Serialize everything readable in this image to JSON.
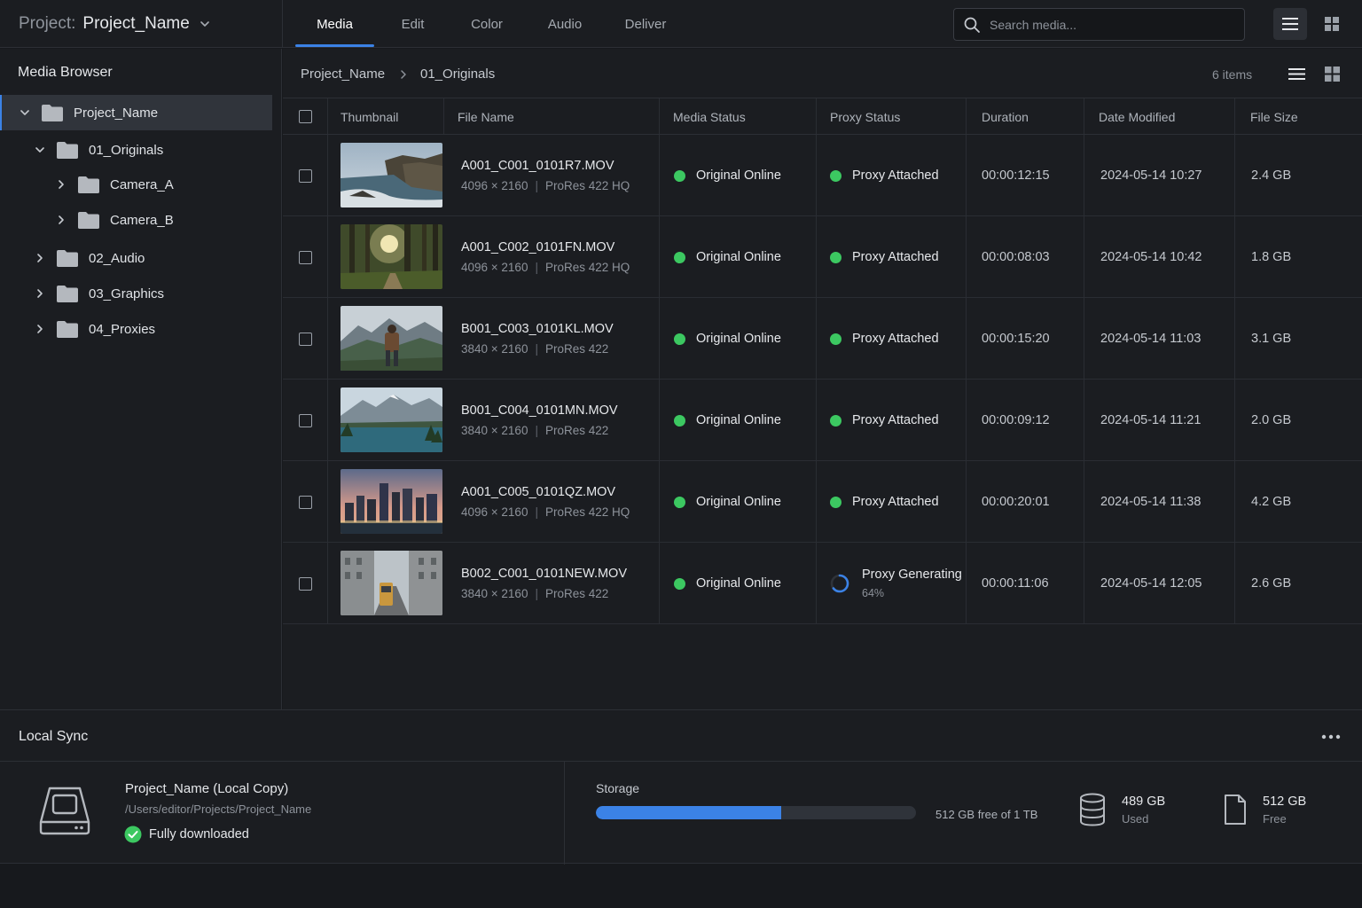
{
  "header": {
    "project_label": "Project:",
    "project_name": "Project_Name",
    "tabs": [
      {
        "label": "Media",
        "active": true
      },
      {
        "label": "Edit"
      },
      {
        "label": "Color"
      },
      {
        "label": "Audio"
      },
      {
        "label": "Deliver"
      }
    ],
    "search_placeholder": "Search media..."
  },
  "sidebar": {
    "title": "Media Browser",
    "tree": [
      {
        "label": "Project_Name",
        "expanded": true,
        "selected": true
      },
      {
        "label": "01_Originals",
        "expanded": true
      },
      {
        "label": "Camera_A"
      },
      {
        "label": "Camera_B"
      },
      {
        "label": "02_Audio"
      },
      {
        "label": "03_Graphics"
      },
      {
        "label": "04_Proxies"
      }
    ]
  },
  "main": {
    "breadcrumb": [
      "Project_Name",
      "01_Originals"
    ],
    "item_count": "6 items",
    "columns": [
      "Thumbnail",
      "File Name",
      "Media Status",
      "Proxy Status",
      "Duration",
      "Date Modified",
      "File Size"
    ],
    "rows": [
      {
        "file": "A001_C001_0101R7.MOV",
        "resolution": "4096 × 2160",
        "codec": "ProRes 422 HQ",
        "media_status": "Original Online",
        "proxy_status": "Proxy Attached",
        "duration": "00:00:12:15",
        "date": "2024-05-14 10:27",
        "size": "2.4 GB",
        "thumb": "coast"
      },
      {
        "file": "A001_C002_0101FN.MOV",
        "resolution": "4096 × 2160",
        "codec": "ProRes 422 HQ",
        "media_status": "Original Online",
        "proxy_status": "Proxy Attached",
        "duration": "00:00:08:03",
        "date": "2024-05-14 10:42",
        "size": "1.8 GB",
        "thumb": "forest"
      },
      {
        "file": "B001_C003_0101KL.MOV",
        "resolution": "3840 × 2160",
        "codec": "ProRes 422",
        "media_status": "Original Online",
        "proxy_status": "Proxy Attached",
        "duration": "00:00:15:20",
        "date": "2024-05-14 11:03",
        "size": "3.1 GB",
        "thumb": "hiker"
      },
      {
        "file": "B001_C004_0101MN.MOV",
        "resolution": "3840 × 2160",
        "codec": "ProRes 422",
        "media_status": "Original Online",
        "proxy_status": "Proxy Attached",
        "duration": "00:00:09:12",
        "date": "2024-05-14 11:21",
        "size": "2.0 GB",
        "thumb": "lake"
      },
      {
        "file": "A001_C005_0101QZ.MOV",
        "resolution": "4096 × 2160",
        "codec": "ProRes 422 HQ",
        "media_status": "Original Online",
        "proxy_status": "Proxy Attached",
        "duration": "00:00:20:01",
        "date": "2024-05-14 11:38",
        "size": "4.2 GB",
        "thumb": "city"
      },
      {
        "file": "B002_C001_0101NEW.MOV",
        "resolution": "3840 × 2160",
        "codec": "ProRes 422",
        "media_status": "Original Online",
        "proxy_status": "Proxy Generating",
        "proxy_progress": "64%",
        "proxy_progress_fraction": 0.64,
        "duration": "00:00:11:06",
        "date": "2024-05-14 12:05",
        "size": "2.6 GB",
        "thumb": "street"
      }
    ]
  },
  "local_sync": {
    "title": "Local Sync",
    "copy_name": "Project_Name (Local Copy)",
    "path": "/Users/editor/Projects/Project_Name",
    "status": "Fully downloaded",
    "storage_label": "Storage",
    "storage_used_fraction": 0.58,
    "free_text": "512 GB free of 1 TB",
    "used_value": "489 GB",
    "used_caption": "Used",
    "free_value": "512 GB",
    "free_caption": "Free"
  },
  "colors": {
    "accent": "#3b82e6",
    "status_green": "#3cc861",
    "background": "#1b1d21"
  }
}
